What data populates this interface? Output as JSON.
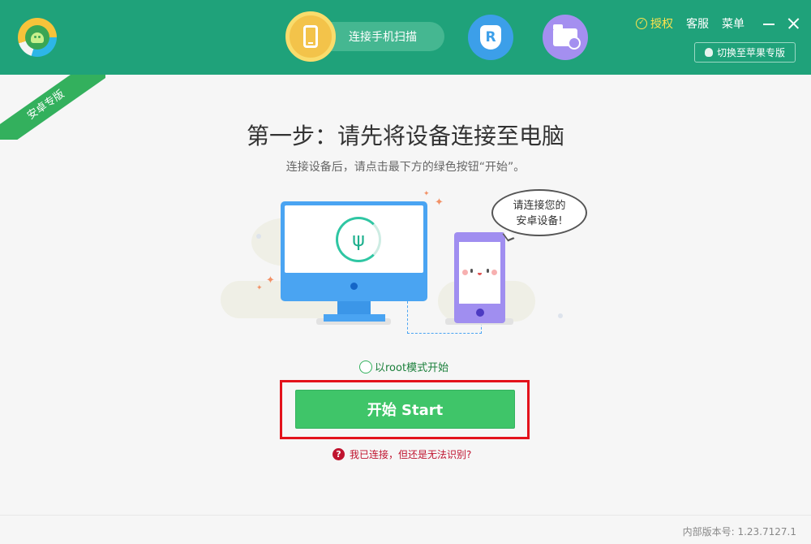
{
  "header": {
    "nav_scan_label": "连接手机扫描",
    "r_badge": "R",
    "auth_label": "授权",
    "service_label": "客服",
    "menu_label": "菜单",
    "apple_switch_label": "切换至苹果专版"
  },
  "ribbon": "安卓专版",
  "main": {
    "title": "第一步：请先将设备连接至电脑",
    "subtitle": "连接设备后，请点击最下方的绿色按钮“开始”。",
    "bubble_line1": "请连接您的",
    "bubble_line2": "安卓设备!",
    "root_option_label": "以root模式开始",
    "start_button_label": "开始  Start",
    "help_label": "我已连接，但还是无法识别?"
  },
  "footer": {
    "version": "内部版本号: 1.23.7127.1"
  },
  "colors": {
    "header_bg": "#1fa27a",
    "start_button": "#3fc569",
    "highlight_border": "#e3121b",
    "help_text": "#c0142f"
  }
}
